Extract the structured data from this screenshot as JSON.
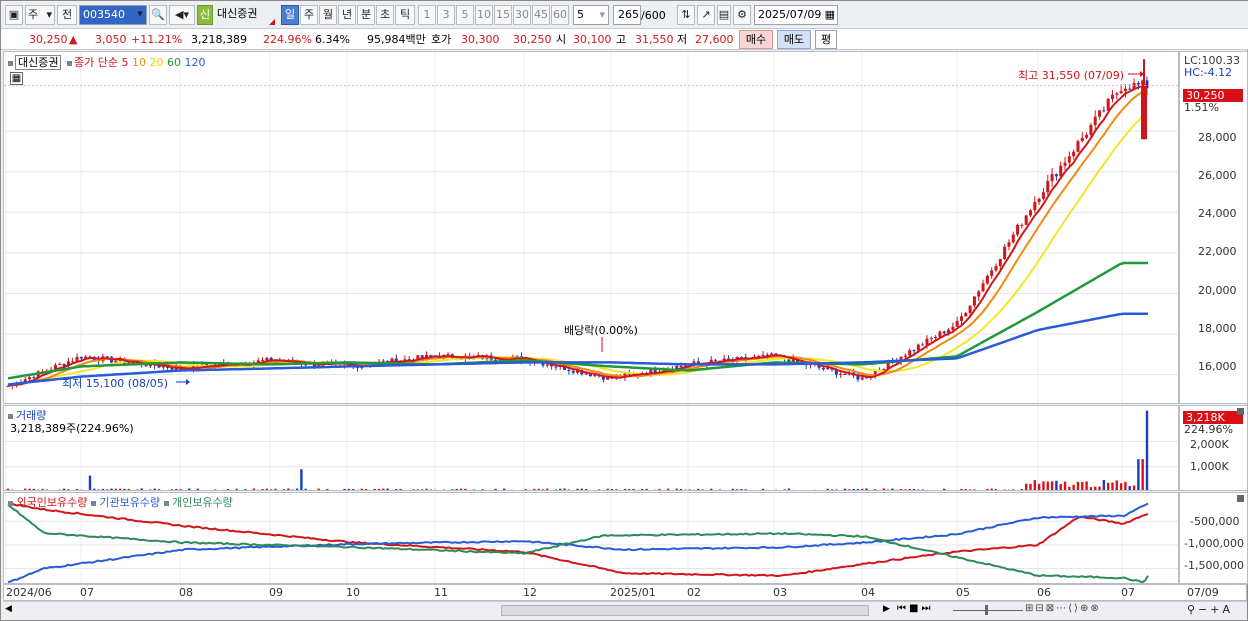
{
  "toolbar": {
    "market": "주",
    "prev": "전",
    "code": "003540",
    "name": "대신증권",
    "credit": "신",
    "periods": [
      "일",
      "주",
      "월",
      "년",
      "분",
      "초",
      "틱"
    ],
    "minutes": [
      "1",
      "3",
      "5",
      "10",
      "15",
      "30",
      "45",
      "60"
    ],
    "unit": "5",
    "count": "265",
    "count_total": "/600",
    "date": "2025/07/09"
  },
  "quote": {
    "price": "30,250",
    "change_sign": "▲",
    "change": "3,050",
    "change_pct": "+11.21%",
    "volume": "3,218,389",
    "vol_ratio": "224.96%",
    "turnover": "6.34%",
    "amount": "95,984백만",
    "hoga_label": "호가",
    "ask": "30,300",
    "bid": "30,250",
    "open_label": "시",
    "open": "30,100",
    "high_label": "고",
    "high": "31,550",
    "low_label": "저",
    "low": "27,600",
    "buy_btn": "매수",
    "sell_btn": "매도",
    "avg_btn": "평"
  },
  "price_pane": {
    "title": "대신증권",
    "legend_prefix": "종가 단순",
    "ma": [
      "5",
      "10",
      "20",
      "60",
      "120"
    ],
    "max_note": "최고 31,550 (07/09)",
    "min_note": "최저 15,100 (08/05)",
    "dividend_note": "배당락(0.00%)",
    "lc": "LC:100.33",
    "hc": "HC:-4.12",
    "last_tag": "30,250",
    "last_pct": "1.51%",
    "yticks": [
      "28,000",
      "26,000",
      "24,000",
      "22,000",
      "20,000",
      "18,000",
      "16,000"
    ]
  },
  "volume_pane": {
    "title": "거래량",
    "value": "3,218,389주(224.96%)",
    "tag": "3,218K",
    "tag_pct": "224.96%",
    "yticks": [
      "2,000K",
      "1,000K"
    ]
  },
  "holding_pane": {
    "legend": [
      "외국인보유수량",
      "기관보유수량",
      "개인보유수량"
    ],
    "yticks": [
      "-500,000",
      "-1,000,000",
      "-1,500,000"
    ]
  },
  "xaxis": [
    "2024/06",
    "07",
    "08",
    "09",
    "10",
    "11",
    "12",
    "2025/01",
    "02",
    "03",
    "04",
    "05",
    "06",
    "07",
    "07/09"
  ],
  "colors": {
    "up": "#d0161b",
    "down": "#1640c0",
    "ma5": "#d0161b",
    "ma10": "#f08a10",
    "ma20": "#f2e62c",
    "ma60": "#1f9a3a",
    "ma120": "#2a5bd7",
    "foreign": "#d0161b",
    "inst": "#2a5bd7",
    "indiv": "#2e8b57"
  },
  "chart_data": {
    "type": "line",
    "title": "대신증권",
    "x": [
      "2024/06",
      "07",
      "08",
      "09",
      "10",
      "11",
      "12",
      "2025/01",
      "02",
      "03",
      "04",
      "05",
      "06",
      "07"
    ],
    "ylim": [
      14500,
      31900
    ],
    "series": [
      {
        "name": "종가",
        "values": [
          15400,
          16900,
          16300,
          16700,
          16400,
          16900,
          16800,
          15800,
          16500,
          16900,
          15800,
          18500,
          24800,
          30250
        ]
      },
      {
        "name": "60",
        "values": [
          15800,
          16400,
          16600,
          16500,
          16600,
          16500,
          16700,
          16400,
          16200,
          16600,
          16500,
          16900,
          19100,
          21500
        ]
      },
      {
        "name": "120",
        "values": [
          15500,
          15900,
          16200,
          16300,
          16400,
          16500,
          16600,
          16600,
          16500,
          16500,
          16600,
          16800,
          18200,
          19000
        ]
      }
    ],
    "high": {
      "label": "최고",
      "value": 31550,
      "date": "07/09"
    },
    "low": {
      "label": "최저",
      "value": 15100,
      "date": "08/05"
    }
  }
}
